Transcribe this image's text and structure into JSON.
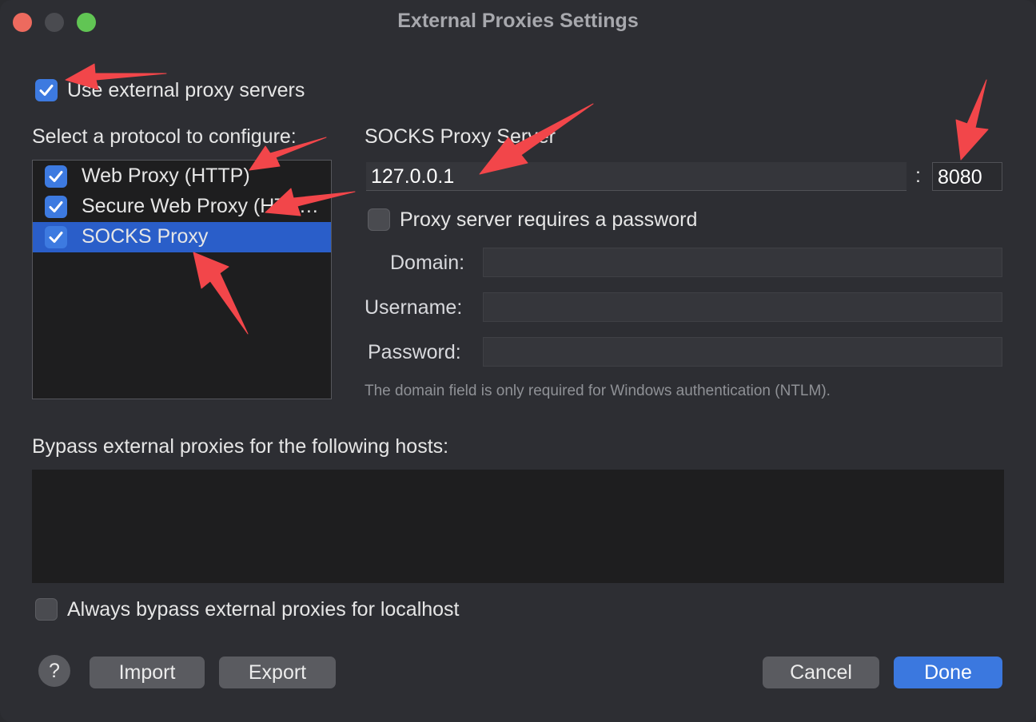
{
  "window": {
    "title": "External Proxies Settings"
  },
  "use_external_proxy": {
    "label": "Use external proxy servers",
    "checked": true
  },
  "protocols": {
    "heading": "Select a protocol to configure:",
    "items": [
      {
        "label": "Web Proxy (HTTP)",
        "checked": true,
        "selected": false
      },
      {
        "label": "Secure Web Proxy (HTTPS)",
        "checked": true,
        "selected": false
      },
      {
        "label": "SOCKS Proxy",
        "checked": true,
        "selected": true
      }
    ]
  },
  "server": {
    "heading": "SOCKS Proxy Server",
    "host": "127.0.0.1",
    "separator": ":",
    "port": "8080",
    "requires_password_label": "Proxy server requires a password",
    "requires_password": false,
    "domain_label": "Domain:",
    "domain_value": "",
    "username_label": "Username:",
    "username_value": "",
    "password_label": "Password:",
    "password_value": "",
    "note": "The domain field is only required for Windows authentication (NTLM)."
  },
  "bypass": {
    "heading": "Bypass external proxies for the following hosts:",
    "hosts": "",
    "localhost_label": "Always bypass external proxies for localhost",
    "localhost_checked": false
  },
  "buttons": {
    "help": "?",
    "import": "Import",
    "export": "Export",
    "cancel": "Cancel",
    "done": "Done"
  },
  "colors": {
    "accent": "#3b78df",
    "selection": "#2a5ec9",
    "annotation_arrow": "#f2464a"
  }
}
